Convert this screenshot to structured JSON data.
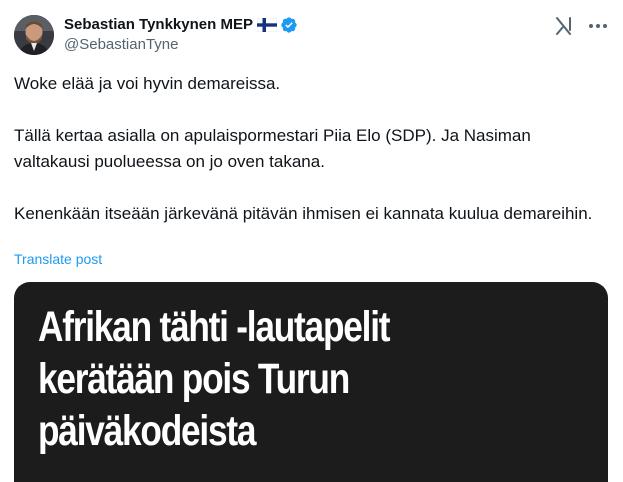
{
  "author": {
    "display_name": "Sebastian Tynkkynen MEP",
    "handle": "@SebastianTyne",
    "flag_icon": "finland-flag-icon",
    "verified_icon": "verified-badge-icon",
    "verified_color": "#1d9bf0"
  },
  "header_actions": {
    "grok_icon": "grok-icon",
    "more_icon": "more-icon"
  },
  "tweet": {
    "paragraphs": [
      "Woke elää ja voi hyvin demareissa.",
      "Tällä kertaa asialla on apulaispormestari Piia Elo (SDP). Ja Nasiman valtakausi puolueessa on jo oven takana.",
      "Kenenkään itseään järkevänä pitävän ihmisen ei kannata kuulua demareihin."
    ],
    "translate_label": "Translate post"
  },
  "media": {
    "headline_lines": [
      "Afrikan tähti -lautapelit",
      "kerätään pois Turun",
      "päiväkodeista"
    ],
    "background_color": "#1c1c1c"
  }
}
